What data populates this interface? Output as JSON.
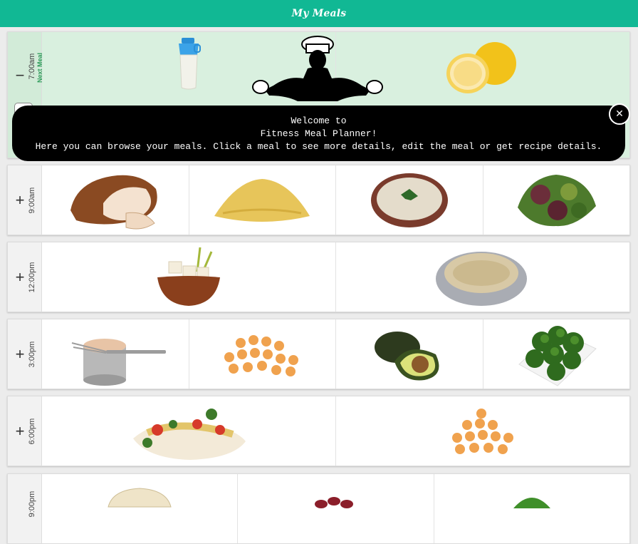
{
  "header": {
    "title": "My Meals"
  },
  "meals": [
    {
      "time": "7:00am",
      "next_label": "Next Meal",
      "toggle": "−",
      "items": [
        "shaker-bottle",
        "grapefruit"
      ]
    },
    {
      "time": "9:00am",
      "toggle": "+",
      "items": [
        "roast-turkey",
        "couscous",
        "hummus-bowl",
        "mixed-greens"
      ]
    },
    {
      "time": "12:00pm",
      "toggle": "+",
      "items": [
        "tofu-bowl",
        "quinoa-bowl"
      ]
    },
    {
      "time": "3:00pm",
      "toggle": "+",
      "items": [
        "canned-tuna",
        "chickpeas",
        "avocado",
        "broccoli"
      ]
    },
    {
      "time": "6:00pm",
      "toggle": "+",
      "items": [
        "baked-fish",
        "chickpeas"
      ]
    },
    {
      "time": "9:00pm",
      "toggle": "+",
      "items": [
        "tortilla-wrap",
        "kidney-beans",
        "green-peas"
      ]
    }
  ],
  "tour": {
    "line1": "Welcome to",
    "line2": "Fitness Meal Planner!",
    "line3": "Here you can browse your meals. Click a meal to see more details, edit the meal or get recipe details.",
    "close": "✕"
  },
  "colors": {
    "header": "#11b894",
    "next_meal_bg": "#d9f0df",
    "next_meal_text": "#2e9b5a"
  }
}
